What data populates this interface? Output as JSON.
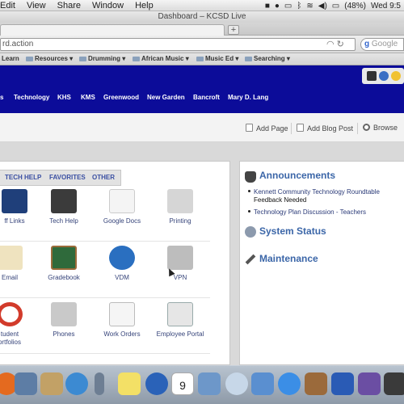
{
  "menubar": {
    "items": [
      "Edit",
      "View",
      "Share",
      "Window",
      "Help"
    ],
    "battery": "(48%)",
    "clock": "Wed 9:5"
  },
  "window": {
    "title": "Dashboard – KCSD Live"
  },
  "tabs": {
    "new_tab": "+"
  },
  "urlbar": {
    "url": "rd.action",
    "search_engine": "Google"
  },
  "bookmarks": {
    "items": [
      "Learn",
      "Resources",
      "Drumming",
      "African Music",
      "Music Ed",
      "Searching"
    ]
  },
  "site": {
    "nav": [
      "s",
      "Technology",
      "KHS",
      "KMS",
      "Greenwood",
      "New Garden",
      "Bancroft",
      "Mary D. Lang"
    ]
  },
  "actions": {
    "add_page": "Add Page",
    "add_blog_post": "Add Blog Post",
    "browse": "Browse"
  },
  "left_panel": {
    "tabs": [
      "TECH HELP",
      "FAVORITES",
      "OTHER"
    ],
    "tiles": [
      {
        "label": "ff Links",
        "icon": "k-logo-icon"
      },
      {
        "label": "Tech Help",
        "icon": "tech-help-icon"
      },
      {
        "label": "Google Docs",
        "icon": "google-docs-icon"
      },
      {
        "label": "Printing",
        "icon": "printer-icon"
      },
      {
        "label": "Email",
        "icon": "envelope-icon"
      },
      {
        "label": "Gradebook",
        "icon": "chalkboard-icon"
      },
      {
        "label": "VDM",
        "icon": "globe-icon"
      },
      {
        "label": "VPN",
        "icon": "padlock-icon"
      },
      {
        "label": "tudent",
        "label2": "ortfolios",
        "icon": "lifebuoy-icon"
      },
      {
        "label": "Phones",
        "icon": "phone-icon"
      },
      {
        "label": "Work Orders",
        "icon": "pencil-paper-icon"
      },
      {
        "label": "Employee Portal",
        "icon": "id-badge-icon"
      }
    ]
  },
  "right_panel": {
    "announcements": {
      "title": "Announcements",
      "items": [
        {
          "title": "Kennett Community Technology Roundtable",
          "sub": "Feedback Needed"
        },
        {
          "title": "Technology Plan Discussion - Teachers",
          "sub": ""
        }
      ]
    },
    "system_status": {
      "title": "System Status"
    },
    "maintenance": {
      "title": "Maintenance"
    }
  },
  "dock": {
    "icons": [
      "firefox-icon",
      "photo-icon",
      "contacts-icon",
      "facetime-icon",
      "clip-icon",
      "stickies-icon",
      "google-earth-icon",
      "calendar-icon",
      "chess-icon",
      "dvd-icon",
      "script-icon",
      "itunes-icon",
      "guitar-icon",
      "word-icon",
      "imovie-icon",
      "misc-icon"
    ],
    "calendar_day": "9"
  },
  "colors": {
    "header_bg": "#0c0c99",
    "link": "#36447a",
    "section_title": "#3b66a8"
  }
}
